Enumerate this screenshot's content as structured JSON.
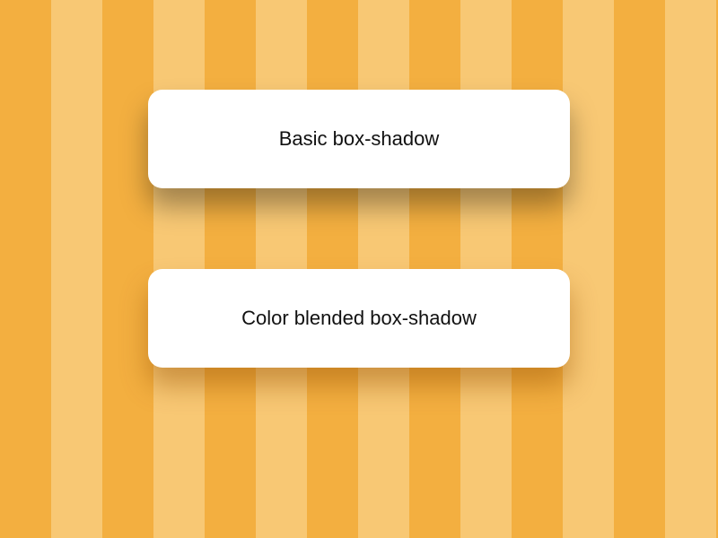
{
  "cards": {
    "basic": {
      "label": "Basic box-shadow"
    },
    "blended": {
      "label": "Color blended box-shadow"
    }
  }
}
